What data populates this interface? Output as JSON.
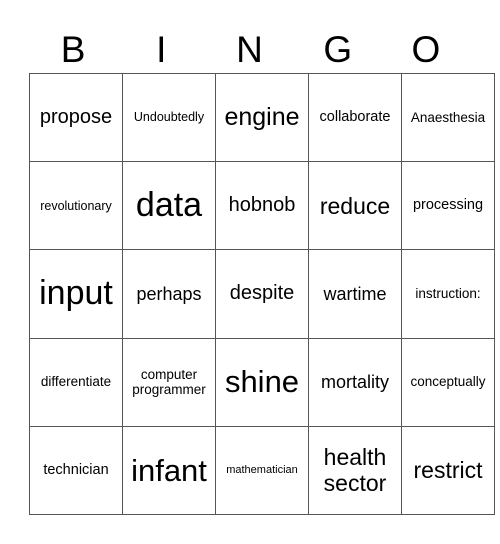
{
  "header": [
    "B",
    "I",
    "N",
    "G",
    "O"
  ],
  "rows": [
    [
      "propose",
      "Undoubtedly",
      "engine",
      "collaborate",
      "Anaesthesia"
    ],
    [
      "revolutionary",
      "data",
      "hobnob",
      "reduce",
      "processing"
    ],
    [
      "input",
      "perhaps",
      "despite",
      "wartime",
      "instruction:"
    ],
    [
      "differentiate",
      "computer programmer",
      "shine",
      "mortality",
      "conceptually"
    ],
    [
      "technician",
      "infant",
      "mathematician",
      "health sector",
      "restrict"
    ]
  ]
}
